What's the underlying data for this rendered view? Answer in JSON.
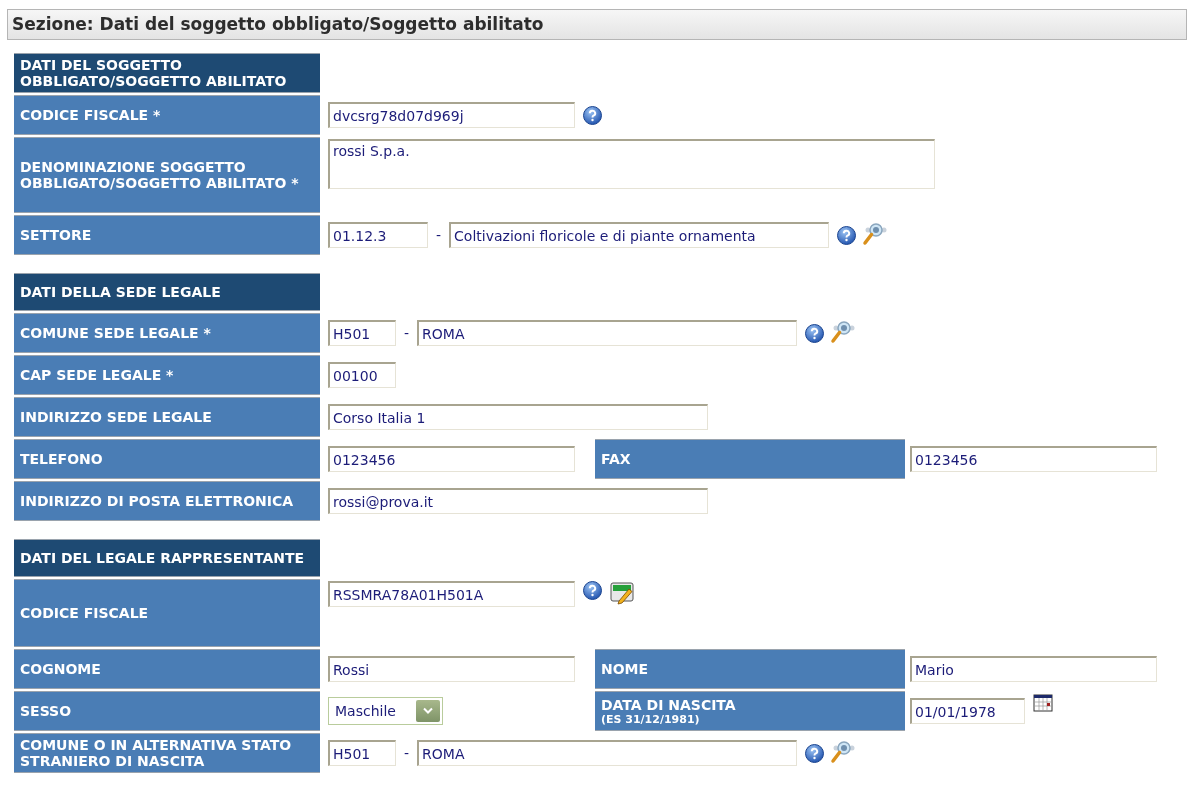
{
  "section_title": "Sezione: Dati del soggetto obbligato/Soggetto abilitato",
  "groups": [
    {
      "title": "DATI DEL SOGGETTO OBBLIGATO/SOGGETTO ABILITATO",
      "rows": [
        {
          "kind": "text",
          "label": "CODICE FISCALE *",
          "inputs": [
            {
              "kind": "medium",
              "value": "dvcsrg78d07d969j"
            }
          ],
          "help": true
        },
        {
          "kind": "textarea",
          "label": "DENOMINAZIONE SOGGETTO OBBLIGATO/SOGGETTO ABILITATO *",
          "inputs": [
            {
              "kind": "wide",
              "value": "rossi S.p.a."
            }
          ]
        },
        {
          "kind": "code_desc",
          "label": "SETTORE",
          "inputs": [
            {
              "kind": "codewide",
              "value": "01.12.3"
            },
            {
              "kind": "large",
              "value": "Coltivazioni floricole e di piante ornamenta"
            }
          ],
          "separator": "-",
          "help": true,
          "lookup": true
        }
      ]
    },
    {
      "title": "DATI DELLA SEDE LEGALE",
      "rows": [
        {
          "kind": "code_desc",
          "label": "COMUNE SEDE LEGALE *",
          "inputs": [
            {
              "kind": "code",
              "value": "H501"
            },
            {
              "kind": "large",
              "value": "ROMA"
            }
          ],
          "separator": "-",
          "help": true,
          "lookup": true
        },
        {
          "kind": "text",
          "label": "CAP SEDE LEGALE *",
          "inputs": [
            {
              "kind": "code",
              "value": "00100"
            }
          ]
        },
        {
          "kind": "text",
          "label": "INDIRIZZO SEDE LEGALE",
          "inputs": [
            {
              "kind": "large",
              "value": "Corso Italia 1"
            }
          ]
        },
        {
          "kind": "pair",
          "label": "TELEFONO",
          "inputs": [
            {
              "kind": "medium",
              "value": "0123456"
            }
          ],
          "label2": "FAX",
          "inputs2": [
            {
              "kind": "medium",
              "value": "0123456"
            }
          ]
        },
        {
          "kind": "text",
          "label": "INDIRIZZO DI POSTA ELETTRONICA",
          "inputs": [
            {
              "kind": "large",
              "value": "rossi@prova.it"
            }
          ]
        }
      ]
    },
    {
      "title": "DATI DEL LEGALE RAPPRESENTANTE",
      "rows": [
        {
          "kind": "tall",
          "label": "CODICE FISCALE",
          "inputs": [
            {
              "kind": "medium",
              "value": "RSSMRA78A01H501A"
            }
          ],
          "help": true,
          "edit": true
        },
        {
          "kind": "pair",
          "label": "COGNOME",
          "inputs": [
            {
              "kind": "medium",
              "value": "Rossi"
            }
          ],
          "label2": "NOME",
          "inputs2": [
            {
              "kind": "medium",
              "value": "Mario"
            }
          ]
        },
        {
          "kind": "select_date",
          "label": "SESSO",
          "select": "Maschile",
          "label2": "DATA DI NASCITA",
          "hint2": "(ES 31/12/1981)",
          "inputs2": [
            {
              "kind": "small",
              "value": "01/01/1978"
            }
          ],
          "calendar": true
        },
        {
          "kind": "code_desc",
          "label": "COMUNE O IN ALTERNATIVA STATO STRANIERO DI NASCITA",
          "inputs": [
            {
              "kind": "code",
              "value": "H501"
            },
            {
              "kind": "large",
              "value": "ROMA"
            }
          ],
          "separator": "-",
          "help": true,
          "lookup": true
        }
      ]
    }
  ]
}
